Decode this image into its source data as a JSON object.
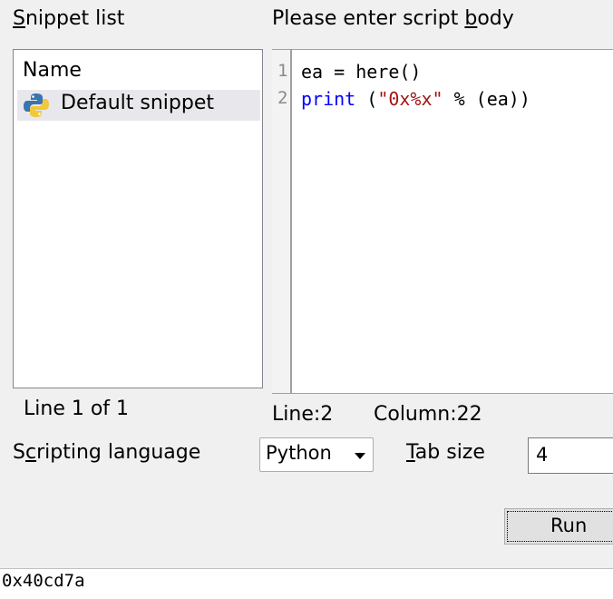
{
  "labels": {
    "snippet_list_rest": "nippet list",
    "snippet_list_key": "S",
    "script_body_pre": "Please enter script ",
    "script_body_key": "b",
    "script_body_post": "ody",
    "scripting_lang_pre": "S",
    "scripting_lang_key": "c",
    "scripting_lang_post": "ripting language",
    "tab_size_key": "T",
    "tab_size_rest": "ab size"
  },
  "snippet_list": {
    "column_header": "Name",
    "items": [
      {
        "label": "Default snippet",
        "icon": "python-icon"
      }
    ],
    "status": "Line 1 of 1"
  },
  "editor": {
    "line_numbers": [
      "1",
      "2"
    ],
    "line1": "ea = here()",
    "line2_kw": "print",
    "line2_open": " (",
    "line2_str": "\"0x%x\"",
    "line2_rest": " % (ea))",
    "status_line": "Line:2",
    "status_column": "Column:22"
  },
  "controls": {
    "language_value": "Python",
    "tab_size_value": "4",
    "run_label": "Run"
  },
  "output": {
    "text": "0x40cd7a"
  },
  "colors": {
    "keyword": "#0000ff",
    "string": "#a31515",
    "selected_row": "#e8e8ec"
  }
}
